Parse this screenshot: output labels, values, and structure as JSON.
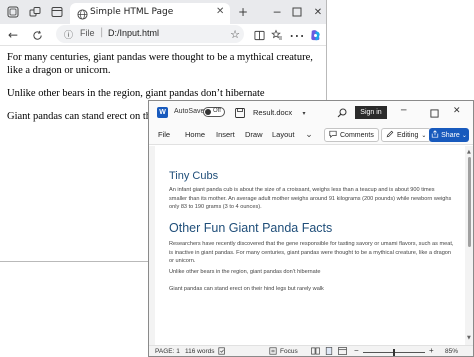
{
  "edge": {
    "tab_title": "Simple HTML Page",
    "url_scheme_label": "File",
    "url": "D:/Input.html",
    "paragraphs": [
      "For many centuries, giant pandas were thought to be a mythical creature, like a dragon or unicorn.",
      "Unlike other bears in the region, giant pandas don’t hibernate",
      "Giant pandas can stand erect on their hi"
    ]
  },
  "word": {
    "autosave_label": "AutoSave",
    "autosave_state": "Off",
    "doc_title": "Result.docx",
    "signin_label": "Sign in",
    "menu": [
      "File",
      "Home",
      "Insert",
      "Draw",
      "Layout"
    ],
    "comments_label": "Comments",
    "editing_label": "Editing",
    "share_label": "Share",
    "document": {
      "heading1": "Tiny Cubs",
      "para1": "An infant giant panda cub is about the size of a croissant, weighs less than a teacup and is about 900 times smaller than its mother. An average adult mother weighs around 91 kilograms (200 pounds) while newborn weighs only 83 to 190 grams (3 to 4 ounces).",
      "heading2": "Other Fun Giant Panda Facts",
      "para2": "Researchers have recently discovered that the gene responsible for tasting savory or umami flavors, such as meat, is inactive in giant pandas. For many centuries, giant pandas were thought to be a mythical creature, like a dragon or unicorn.",
      "para3": "Unlike other bears in the region, giant pandas don’t hibernate",
      "para4": "Giant pandas can stand erect on their hind legs but rarely walk"
    },
    "status": {
      "page": "PAGE: 1",
      "words": "116 words",
      "focus": "Focus",
      "zoom": "85%"
    }
  },
  "colors": {
    "word_blue": "#185abd",
    "heading_blue": "#1f4e79",
    "edge_tabbar": "#e9eaed"
  }
}
